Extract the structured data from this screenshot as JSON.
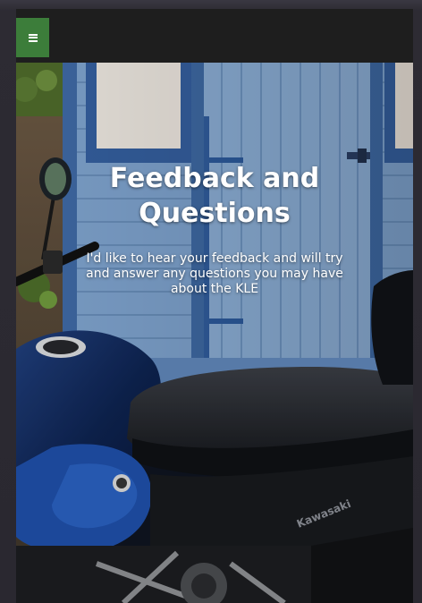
{
  "header": {
    "menu_icon": "hamburger-menu-icon",
    "menu_color": "#3c7d3a"
  },
  "hero": {
    "title": "Feedback and Questions",
    "subtitle": "I'd like to hear your feedback and will try and answer any questions you may have about the KLE",
    "background_image": "blue-shed-and-motorcycle-photo"
  }
}
